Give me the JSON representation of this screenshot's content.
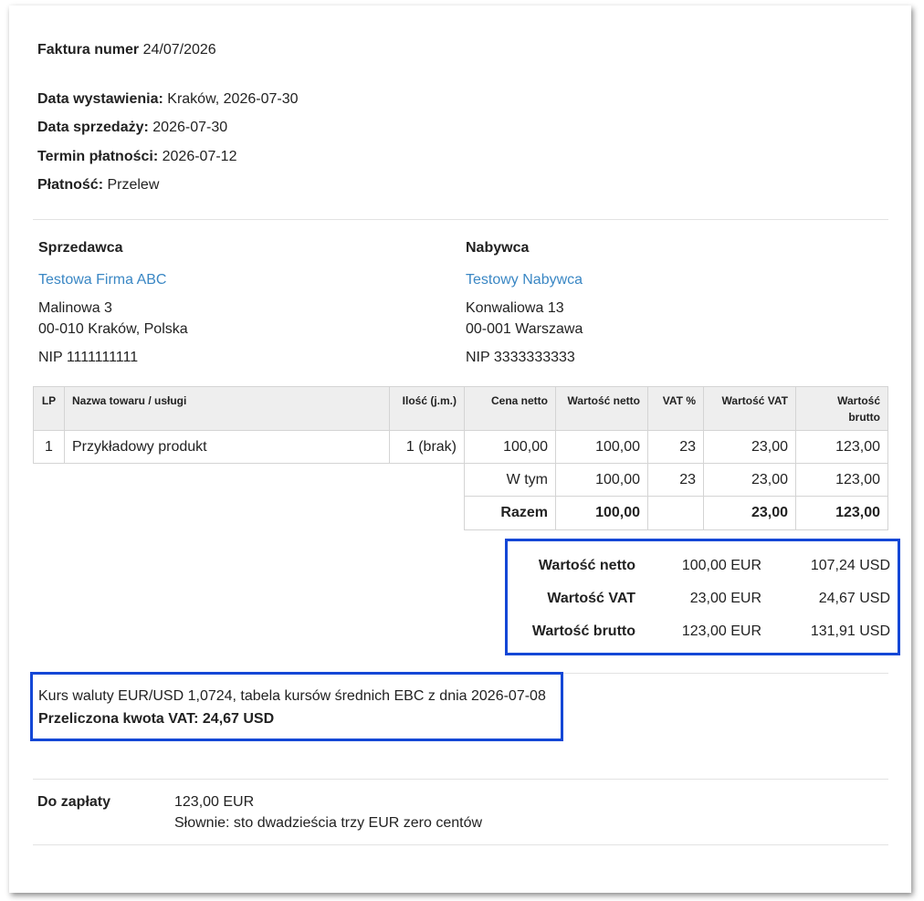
{
  "invoice": {
    "number_label": "Faktura numer",
    "number": "24/07/2026",
    "issue_label": "Data wystawienia:",
    "issue_value": "Kraków, 2026-07-30",
    "sale_label": "Data sprzedaży:",
    "sale_value": "2026-07-30",
    "due_label": "Termin płatności:",
    "due_value": "2026-07-12",
    "payment_label": "Płatność:",
    "payment_value": "Przelew"
  },
  "seller": {
    "heading": "Sprzedawca",
    "name": "Testowa Firma ABC",
    "street": "Malinowa 3",
    "city": "00-010 Kraków, Polska",
    "nip": "NIP 1111111111"
  },
  "buyer": {
    "heading": "Nabywca",
    "name": "Testowy Nabywca",
    "street": "Konwaliowa 13",
    "city": "00-001 Warszawa",
    "nip": "NIP 3333333333"
  },
  "table": {
    "headers": [
      "LP",
      "Nazwa towaru / usługi",
      "Ilość (j.m.)",
      "Cena netto",
      "Wartość netto",
      "VAT %",
      "Wartość VAT",
      "Wartość",
      "brutto"
    ],
    "rows": [
      {
        "lp": "1",
        "name": "Przykładowy produkt",
        "qty": "1 (brak)",
        "price": "100,00",
        "net": "100,00",
        "vat_pct": "23",
        "vat": "23,00",
        "gross": "123,00"
      }
    ],
    "wtym": {
      "label": "W tym",
      "net": "100,00",
      "vat_pct": "23",
      "vat": "23,00",
      "gross": "123,00"
    },
    "razem": {
      "label": "Razem",
      "net": "100,00",
      "vat": "23,00",
      "gross": "123,00"
    }
  },
  "fx_summary": [
    {
      "label": "Wartość netto",
      "eur": "100,00 EUR",
      "usd": "107,24 USD"
    },
    {
      "label": "Wartość VAT",
      "eur": "23,00 EUR",
      "usd": "24,67 USD"
    },
    {
      "label": "Wartość brutto",
      "eur": "123,00 EUR",
      "usd": "131,91 USD"
    }
  ],
  "exchange": {
    "rate_text": "Kurs waluty EUR/USD 1,0724, tabela kursów średnich EBC z dnia 2026-07-08",
    "vat_converted": "Przeliczona kwota VAT: 24,67 USD"
  },
  "to_pay": {
    "label": "Do zapłaty",
    "amount": "123,00 EUR",
    "words": "Słownie: sto dwadzieścia trzy EUR zero centów"
  },
  "colors": {
    "link": "#3a87c4",
    "highlight_border": "#1447d6"
  }
}
